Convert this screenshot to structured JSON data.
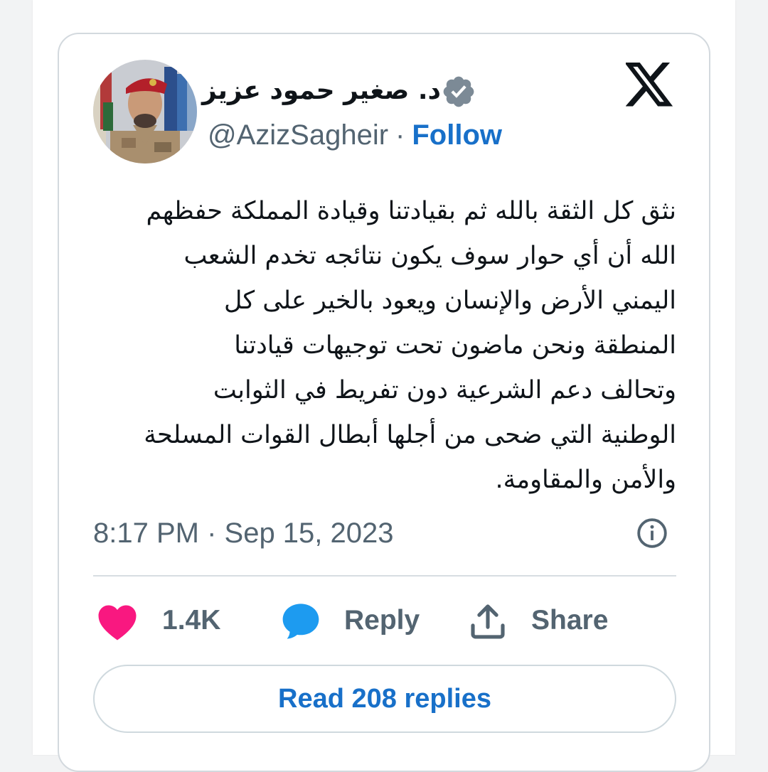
{
  "author": {
    "name": "د. صغير حمود عزيز",
    "handle": "@AzizSagheir",
    "separator": "·",
    "follow_label": "Follow",
    "verified_icon": "verified-badge-icon",
    "verified_color": "#7c8a96"
  },
  "tweet": {
    "text": "نثق كل الثقة بالله ثم بقيادتنا وقيادة المملكة حفظهم\nالله أن أي حوار سوف يكون نتائجه تخدم الشعب\nاليمني الأرض والإنسان ويعود بالخير على كل\nالمنطقة ونحن ماضون تحت توجيهات قيادتنا\nوتحالف دعم الشرعية دون تفريط في الثوابت\nالوطنية التي ضحى من أجلها أبطال القوات المسلحة\nوالأمن والمقاومة.",
    "timestamp": "8:17 PM · Sep 15, 2023"
  },
  "actions": {
    "likes_count": "1.4K",
    "reply_label": "Reply",
    "share_label": "Share"
  },
  "read_replies_label": "Read 208 replies",
  "icons": [
    "x-logo-icon",
    "info-icon",
    "heart-icon",
    "reply-bubble-icon",
    "share-icon"
  ],
  "colors": {
    "accent": "#1870c9",
    "like": "#f91880",
    "reply": "#1d9bf0",
    "secondary_text": "#536471",
    "primary_text": "#0f1419",
    "border": "#d3d9de"
  }
}
